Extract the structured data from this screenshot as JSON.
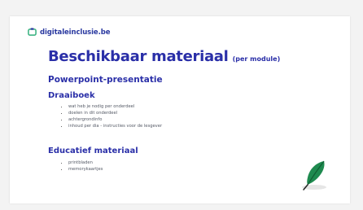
{
  "logo": {
    "text": "digitaleinclusie.be",
    "icon": "brand-logo-icon"
  },
  "slide": {
    "title": "Beschikbaar materiaal",
    "title_suffix": "(per module)",
    "section_powerpoint": "Powerpoint-presentatie",
    "section_draaiboek": "Draaiboek",
    "draaiboek_items": [
      "wat heb je nodig per onderdeel",
      "doelen in dit onderdeel",
      "achtergrondinfo",
      "inhoud per dia - instructies voor de lesgever"
    ],
    "section_educatief": "Educatief materiaal",
    "educatief_items": [
      "printbladen",
      "memorykaartjes"
    ],
    "illustration": "feather-quill-icon"
  },
  "colors": {
    "accent": "#2a2fa8",
    "feather": "#1e8a4f"
  }
}
